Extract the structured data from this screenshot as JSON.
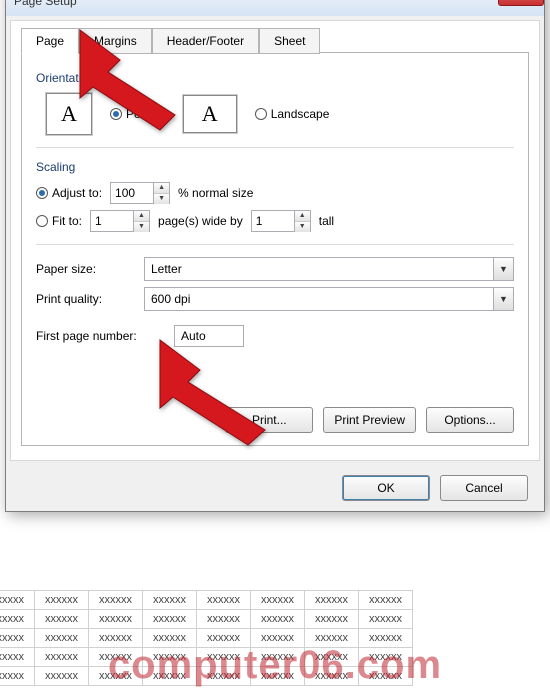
{
  "window": {
    "title": "Page Setup",
    "close_glyph": "✕"
  },
  "tabs": [
    {
      "label": "Page",
      "active": true
    },
    {
      "label": "Margins",
      "active": false
    },
    {
      "label": "Header/Footer",
      "active": false
    },
    {
      "label": "Sheet",
      "active": false
    }
  ],
  "orientation": {
    "section_label": "Orientation",
    "portrait_label": "Portrait",
    "landscape_label": "Landscape",
    "selected": "portrait",
    "icon_glyph": "A"
  },
  "scaling": {
    "section_label": "Scaling",
    "adjust_label": "Adjust to:",
    "adjust_value": "100",
    "adjust_suffix": "% normal size",
    "fit_label": "Fit to:",
    "fit_wide_value": "1",
    "fit_mid_text": "page(s) wide by",
    "fit_tall_value": "1",
    "fit_tall_suffix": "tall",
    "selected": "adjust"
  },
  "paper": {
    "size_label": "Paper size:",
    "size_value": "Letter",
    "quality_label": "Print quality:",
    "quality_value": "600 dpi"
  },
  "first_page": {
    "label": "First page number:",
    "value": "Auto"
  },
  "buttons": {
    "print": "Print...",
    "preview": "Print Preview",
    "options": "Options...",
    "ok": "OK",
    "cancel": "Cancel"
  },
  "sheet_cell": "xxxxxx",
  "watermark": "computer06.com"
}
